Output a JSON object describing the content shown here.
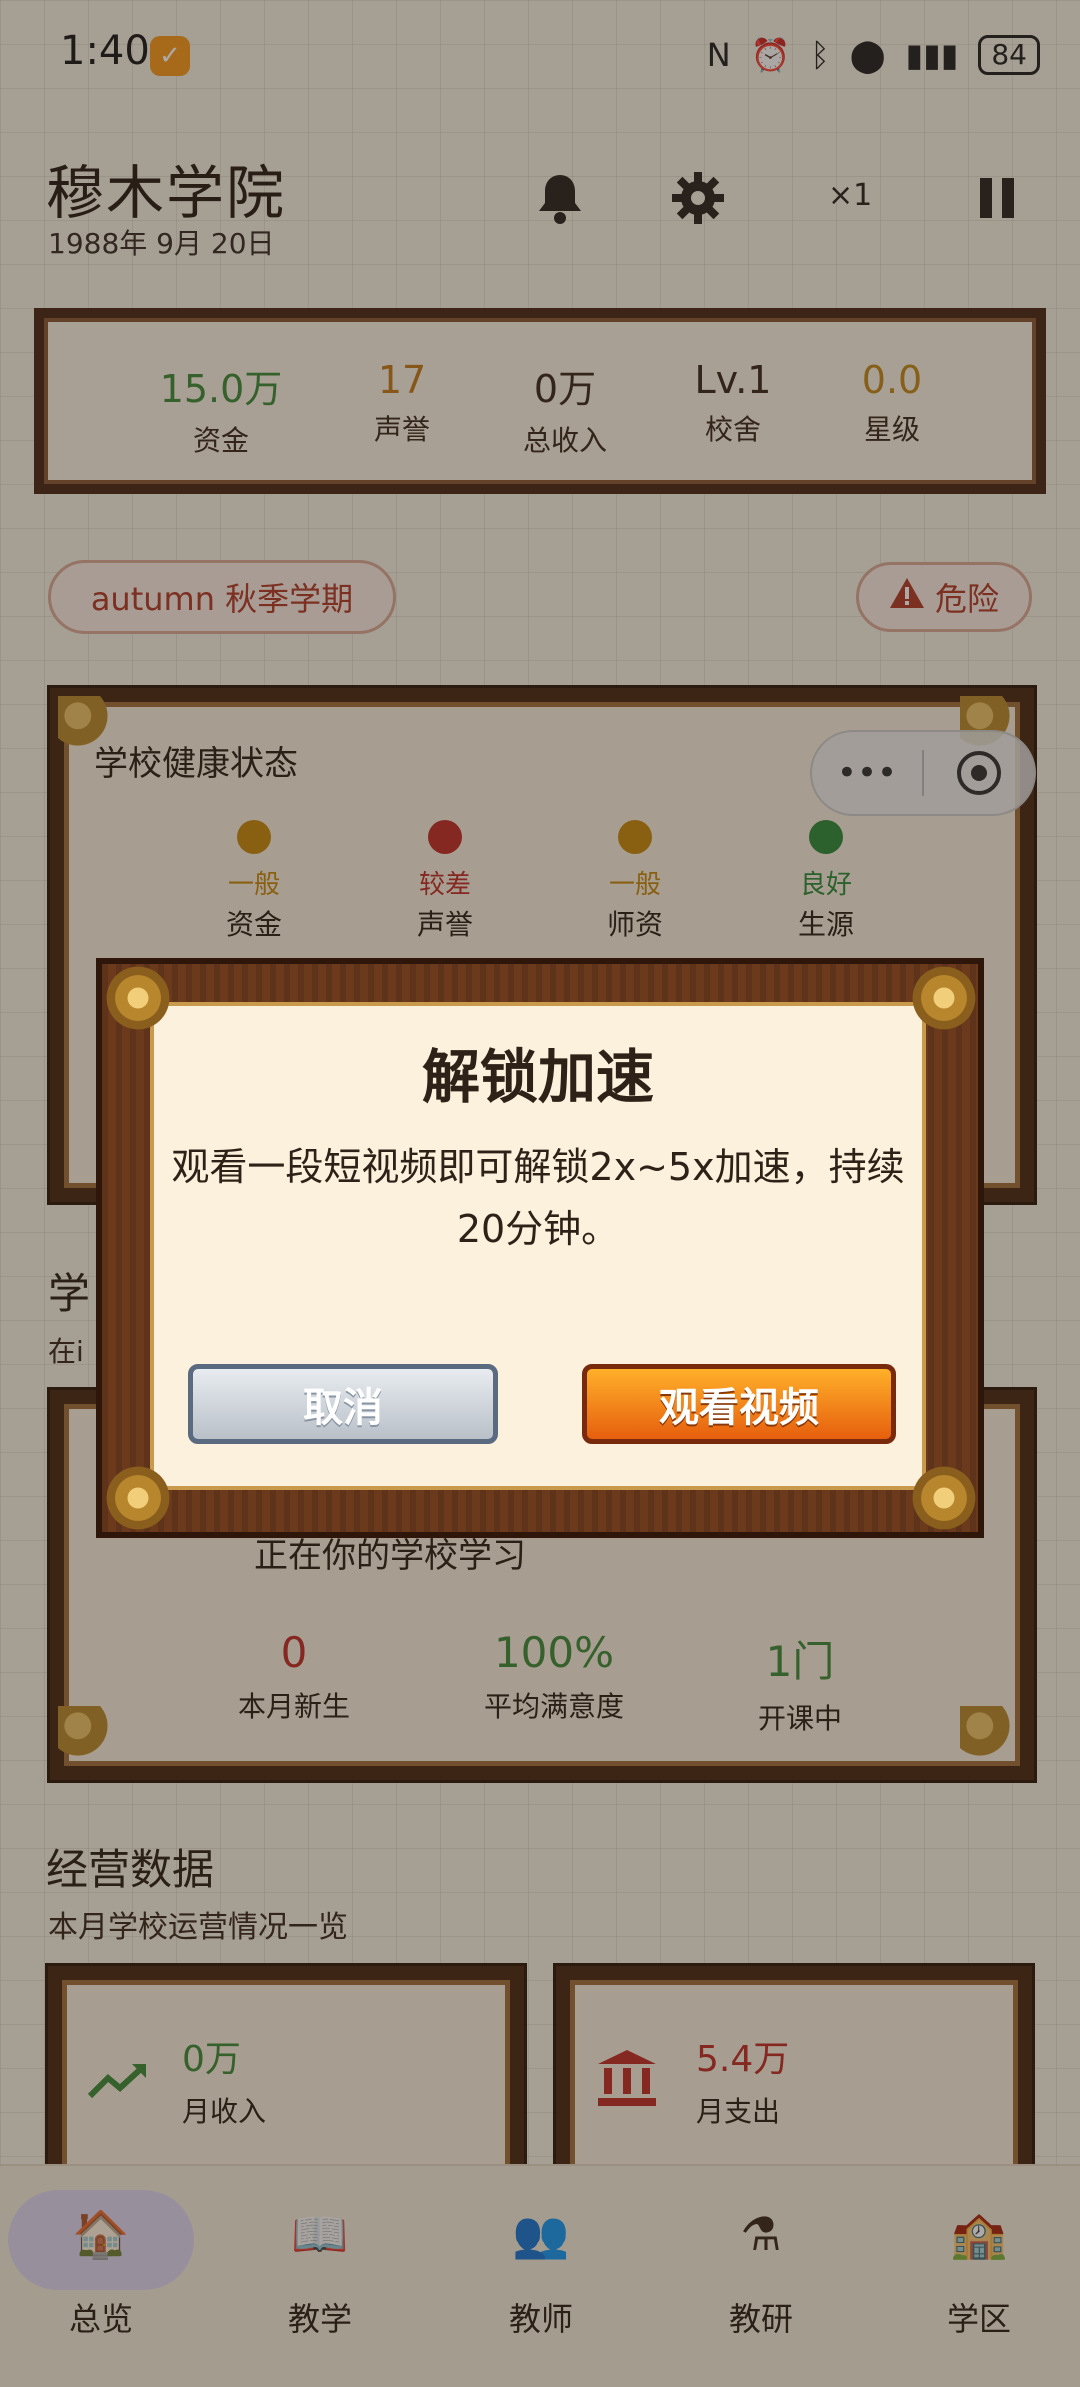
{
  "status_bar": {
    "time": "1:40",
    "battery": "84"
  },
  "header": {
    "title": "穆木学院",
    "date": "1988年 9月 20日",
    "speed": "×1"
  },
  "stats": [
    {
      "value": "15.0万",
      "label": "资金",
      "color": "#3f8a3a"
    },
    {
      "value": "17",
      "label": "声誉",
      "color": "#c07a1e"
    },
    {
      "value": "0万",
      "label": "总收入",
      "color": "#2e2218"
    },
    {
      "value": "Lv.1",
      "label": "校舍",
      "color": "#2e2218"
    },
    {
      "value": "0.0",
      "label": "星级",
      "color": "#c08a1e"
    }
  ],
  "term_pill": "autumn 秋季学期",
  "danger_pill": "危险",
  "health": {
    "title": "学校健康状态",
    "items": [
      {
        "level": "一般",
        "label": "资金",
        "color": "#c58a10"
      },
      {
        "level": "较差",
        "label": "声誉",
        "color": "#c0302a"
      },
      {
        "level": "一般",
        "label": "师资",
        "color": "#c58a10"
      },
      {
        "level": "良好",
        "label": "生源",
        "color": "#2f8a3a"
      }
    ]
  },
  "students": {
    "title": "学",
    "subtitle": "在i",
    "text": "正在你的学校学习",
    "stats": [
      {
        "value": "0",
        "label": "本月新生",
        "color": "#c0302a"
      },
      {
        "value": "100%",
        "label": "平均满意度",
        "color": "#3f8a3a"
      },
      {
        "value": "1门",
        "label": "开课中",
        "color": "#3f8a3a"
      }
    ]
  },
  "ops": {
    "title": "经营数据",
    "subtitle": "本月学校运营情况一览",
    "cards": [
      {
        "value": "0万",
        "label": "月收入",
        "color": "#3f8a3a",
        "icon": "trend-up-icon"
      },
      {
        "value": "5.4万",
        "label": "月支出",
        "color": "#c0302a",
        "icon": "bank-icon"
      }
    ]
  },
  "nav": [
    {
      "label": "总览",
      "icon": "school-house-icon"
    },
    {
      "label": "教学",
      "icon": "book-icon"
    },
    {
      "label": "教师",
      "icon": "teachers-icon"
    },
    {
      "label": "教研",
      "icon": "flask-icon"
    },
    {
      "label": "学区",
      "icon": "campus-icon"
    }
  ],
  "modal": {
    "title": "解锁加速",
    "description": "观看一段短视频即可解锁2x~5x加速，持续20分钟。",
    "cancel_label": "取消",
    "watch_label": "观看视频"
  }
}
